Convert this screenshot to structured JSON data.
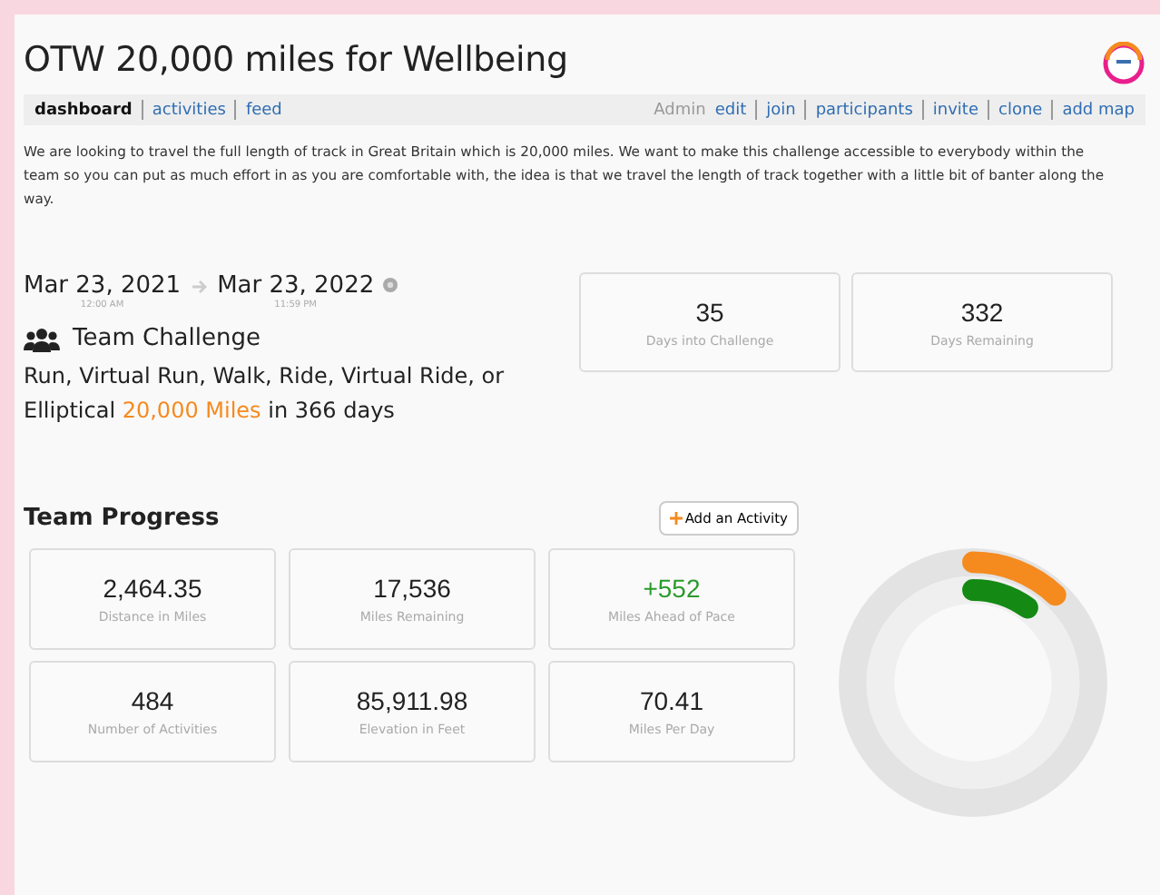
{
  "title": "OTW 20,000 miles for Wellbeing",
  "tabs": [
    {
      "label": "dashboard",
      "selected": true
    },
    {
      "label": "activities",
      "selected": false
    },
    {
      "label": "feed",
      "selected": false
    }
  ],
  "admin": {
    "label": "Admin",
    "links": [
      "edit",
      "join",
      "participants",
      "invite",
      "clone",
      "add map"
    ]
  },
  "description": "We are looking to travel the full length of track in Great Britain which is 20,000 miles. We want to make this challenge accessible to everybody within the team so you can put as much effort in as you are comfortable with, the idea is that we travel the length of track together with a little bit of banter along the way.",
  "start": {
    "date": "Mar 23, 2021",
    "time": "12:00 AM"
  },
  "end": {
    "date": "Mar 23, 2022",
    "time": "11:59 PM"
  },
  "challenge_type": "Team Challenge",
  "goal": {
    "activities": "Run, Virtual Run, Walk, Ride, Virtual Ride, or Elliptical",
    "target": "20,000 Miles",
    "duration": "in 366 days"
  },
  "day_stats": [
    {
      "value": "35",
      "label": "Days into Challenge"
    },
    {
      "value": "332",
      "label": "Days Remaining"
    }
  ],
  "progress": {
    "heading": "Team Progress",
    "add_button": "Add an Activity",
    "stats": [
      {
        "value": "2,464.35",
        "label": "Distance in Miles",
        "kind": "plain"
      },
      {
        "value": "17,536",
        "label": "Miles Remaining",
        "kind": "plain"
      },
      {
        "value": "+552",
        "label": "Miles Ahead of Pace",
        "kind": "positive"
      },
      {
        "value": "484",
        "label": "Number of Activities",
        "kind": "plain"
      },
      {
        "value": "85,911.98",
        "label": "Elevation in Feet",
        "kind": "plain"
      },
      {
        "value": "70.41",
        "label": "Miles Per Day",
        "kind": "plain"
      }
    ]
  }
}
